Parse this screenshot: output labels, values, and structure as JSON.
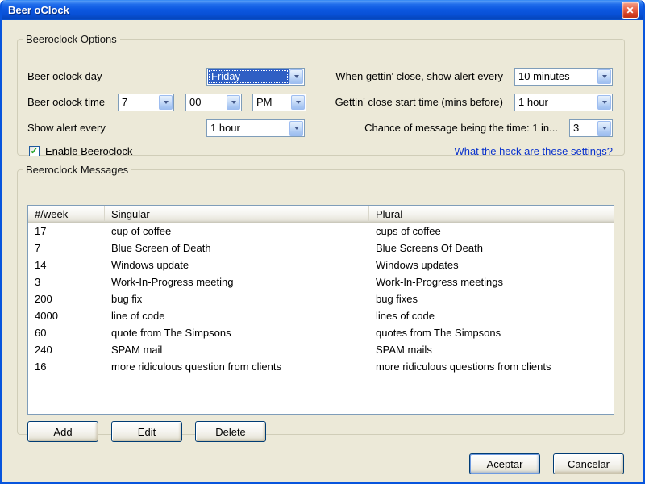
{
  "window": {
    "title": "Beer oClock",
    "close_glyph": "✕"
  },
  "options": {
    "legend": "Beeroclock Options",
    "day_label": "Beer oclock day",
    "day_value": "Friday",
    "time_label": "Beer oclock time",
    "time_hour": "7",
    "time_min": "00",
    "time_ampm": "PM",
    "alert_label": "Show alert every",
    "alert_value": "1 hour",
    "enable_label": "Enable Beeroclock",
    "check_glyph": "✓",
    "close_alert_label": "When gettin' close, show alert every",
    "close_alert_value": "10 minutes",
    "close_start_label": "Gettin' close start time (mins before)",
    "close_start_value": "1 hour",
    "chance_label": "Chance of message being the time: 1 in...",
    "chance_value": "3",
    "help_link": "What the heck are these settings?"
  },
  "messages": {
    "legend": "Beeroclock Messages",
    "columns": [
      "#/week",
      "Singular",
      "Plural"
    ],
    "rows": [
      [
        "17",
        "cup of coffee",
        "cups of coffee"
      ],
      [
        "7",
        "Blue Screen of Death",
        "Blue Screens Of Death"
      ],
      [
        "14",
        "Windows update",
        "Windows updates"
      ],
      [
        "3",
        "Work-In-Progress meeting",
        "Work-In-Progress meetings"
      ],
      [
        "200",
        "bug fix",
        "bug fixes"
      ],
      [
        "4000",
        "line of code",
        "lines of code"
      ],
      [
        "60",
        "quote from The Simpsons",
        "quotes from The Simpsons"
      ],
      [
        "240",
        "SPAM mail",
        "SPAM mails"
      ],
      [
        "16",
        "more ridiculous question from clients",
        "more ridiculous questions from clients"
      ]
    ],
    "add_label": "Add",
    "edit_label": "Edit",
    "delete_label": "Delete"
  },
  "footer": {
    "ok_label": "Aceptar",
    "cancel_label": "Cancelar"
  },
  "colors": {
    "titlebar_blue": "#0d59e2",
    "window_border": "#0855dd",
    "dialog_bg": "#ece9d8",
    "selection_blue": "#2f5fc4",
    "link_blue": "#0a32cc",
    "check_green": "#21a121"
  }
}
